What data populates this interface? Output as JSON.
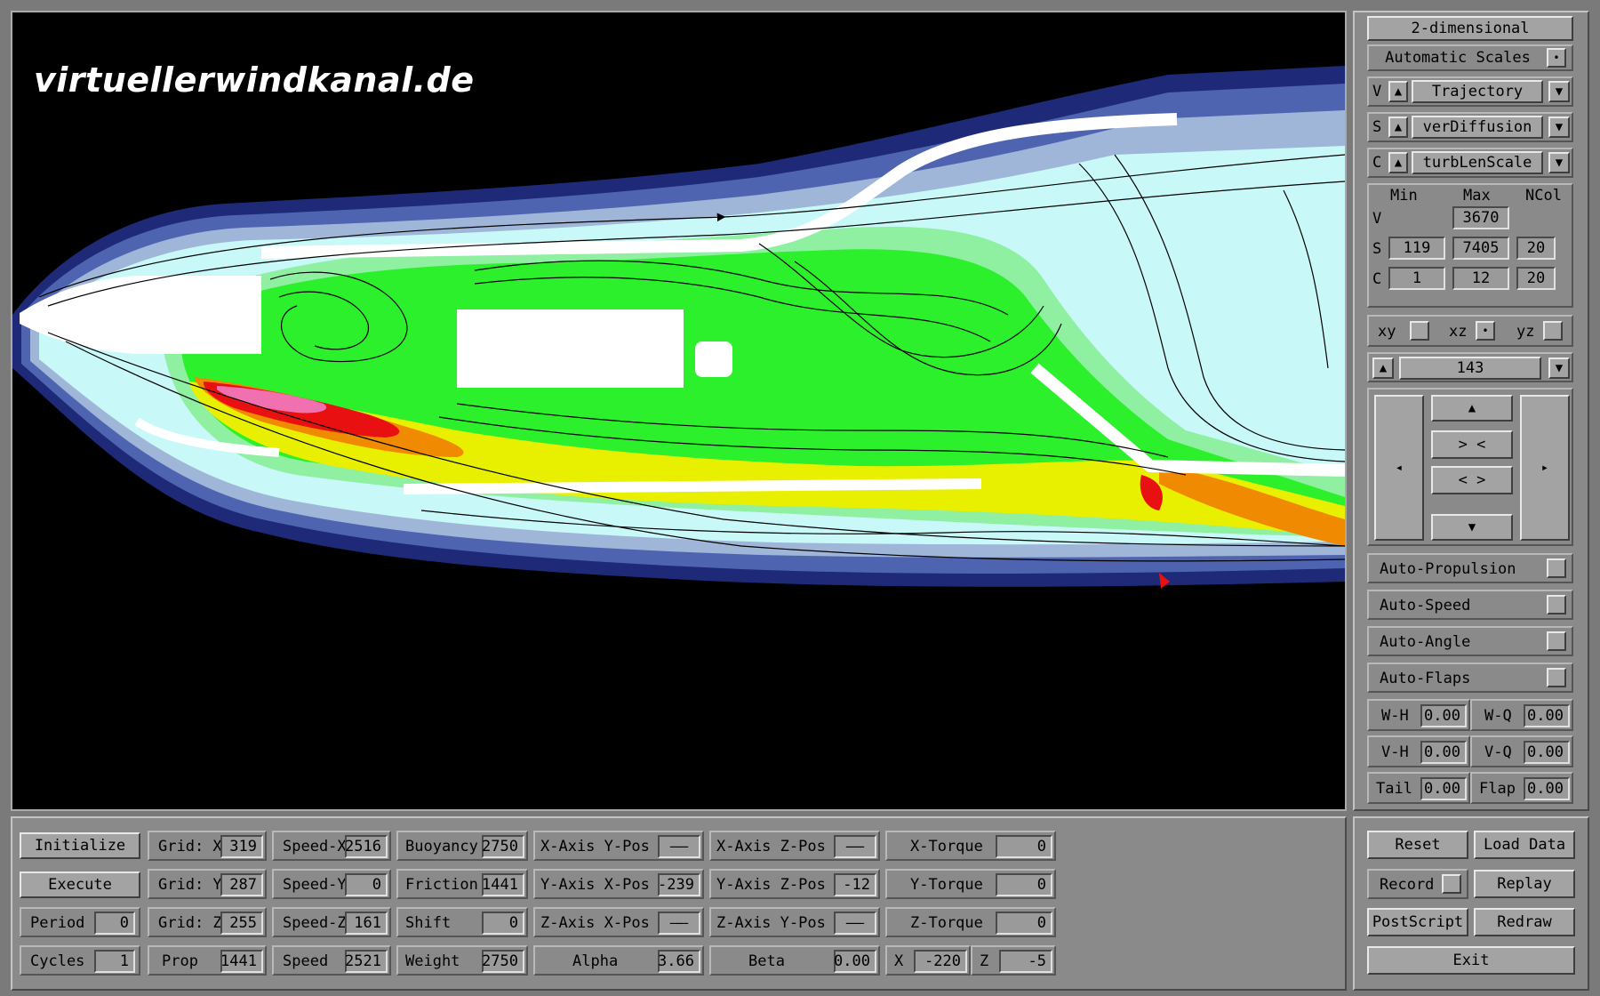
{
  "watermark": "virtuellerwindkanal.de",
  "side": {
    "mode": "2-dimensional",
    "auto_scales": {
      "label": "Automatic Scales",
      "checked": "•"
    },
    "selectors": [
      {
        "key": "V",
        "value": "Trajectory"
      },
      {
        "key": "S",
        "value": "verDiffusion"
      },
      {
        "key": "C",
        "value": "turbLenScale"
      }
    ],
    "range": {
      "headers": {
        "min": "Min",
        "max": "Max",
        "ncol": "NCol"
      },
      "v": {
        "label": "V",
        "max": "3670"
      },
      "s": {
        "label": "S",
        "min": "119",
        "max": "7405",
        "ncol": "20"
      },
      "c": {
        "label": "C",
        "min": "1",
        "max": "12",
        "ncol": "20"
      }
    },
    "planes": [
      {
        "label": "xy",
        "mark": ""
      },
      {
        "label": "xz",
        "mark": "•"
      },
      {
        "label": "yz",
        "mark": ""
      }
    ],
    "slice": "143",
    "nav": {
      "zoom_in": "> <",
      "zoom_out": "< >"
    },
    "autos": [
      "Auto-Propulsion",
      "Auto-Speed",
      "Auto-Angle",
      "Auto-Flaps"
    ],
    "wings": [
      {
        "l1": "W-H",
        "v1": "0.00",
        "l2": "W-Q",
        "v2": "0.00"
      },
      {
        "l1": "V-H",
        "v1": "0.00",
        "l2": "V-Q",
        "v2": "0.00"
      },
      {
        "l1": "Tail",
        "v1": "0.00",
        "l2": "Flap",
        "v2": "0.00"
      }
    ]
  },
  "bottom": {
    "initialize": "Initialize",
    "execute": "Execute",
    "period": {
      "label": "Period",
      "value": "0"
    },
    "cycles": {
      "label": "Cycles",
      "value": "1"
    },
    "grid_x": {
      "label": "Grid: X",
      "value": "319"
    },
    "grid_y": {
      "label": "Grid: Y",
      "value": "287"
    },
    "grid_z": {
      "label": "Grid: Z",
      "value": "255"
    },
    "prop": {
      "label": "Prop",
      "value": "1441"
    },
    "speed_x": {
      "label": "Speed-X",
      "value": "2516"
    },
    "speed_y": {
      "label": "Speed-Y",
      "value": "0"
    },
    "speed_z": {
      "label": "Speed-Z",
      "value": "161"
    },
    "speed": {
      "label": "Speed",
      "value": "2521"
    },
    "buoyancy": {
      "label": "Buoyancy",
      "value": "2750"
    },
    "friction": {
      "label": "Friction",
      "value": "1441"
    },
    "shift": {
      "label": "Shift",
      "value": "0"
    },
    "weight": {
      "label": "Weight",
      "value": "2750"
    },
    "xaxis_ypos": {
      "label": "X-Axis Y-Pos",
      "value": "——"
    },
    "yaxis_xpos": {
      "label": "Y-Axis X-Pos",
      "value": "-239"
    },
    "zaxis_xpos": {
      "label": "Z-Axis X-Pos",
      "value": "——"
    },
    "alpha": {
      "label": "Alpha",
      "value": "3.66"
    },
    "xaxis_zpos": {
      "label": "X-Axis Z-Pos",
      "value": "——"
    },
    "yaxis_zpos": {
      "label": "Y-Axis Z-Pos",
      "value": "-12"
    },
    "zaxis_ypos": {
      "label": "Z-Axis Y-Pos",
      "value": "——"
    },
    "beta": {
      "label": "Beta",
      "value": "0.00"
    },
    "x_torque": {
      "label": "X-Torque",
      "value": "0"
    },
    "y_torque": {
      "label": "Y-Torque",
      "value": "0"
    },
    "z_torque": {
      "label": "Z-Torque",
      "value": "0"
    },
    "x": {
      "label": "X",
      "value": "-220"
    },
    "z": {
      "label": "Z",
      "value": "-5"
    }
  },
  "actions": {
    "reset": "Reset",
    "load_data": "Load Data",
    "record": "Record",
    "replay": "Replay",
    "postscript": "PostScript",
    "redraw": "Redraw",
    "exit": "Exit"
  },
  "colors": {
    "dark_blue": "#1e2a78",
    "mid_blue": "#4f64b0",
    "steel": "#9fb6d8",
    "pale_cyan": "#c8f8f8",
    "light_green": "#8ef0a0",
    "green": "#2cf02c",
    "yellow": "#e8f000",
    "orange": "#f08a00",
    "red": "#e81010",
    "pink": "#f070b0"
  }
}
